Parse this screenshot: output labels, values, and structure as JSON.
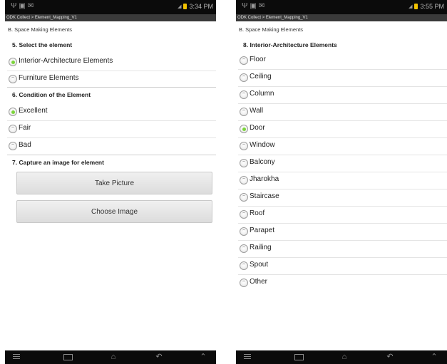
{
  "left": {
    "status_time": "3:34 PM",
    "app_title": "ODK Collect > Element_Mapping_V1",
    "section": "B. Space Making Elements",
    "q5": {
      "text": "5. Select the element",
      "options": [
        {
          "label": "Interior-Architecture Elements",
          "checked": true
        },
        {
          "label": "Furniture Elements",
          "checked": false
        }
      ]
    },
    "q6": {
      "text": "6. Condition of the Element",
      "options": [
        {
          "label": "Excellent",
          "checked": true
        },
        {
          "label": "Fair",
          "checked": false
        },
        {
          "label": "Bad",
          "checked": false
        }
      ]
    },
    "q7": {
      "text": "7. Capture an image for element",
      "take_picture": "Take Picture",
      "choose_image": "Choose Image"
    }
  },
  "right": {
    "status_time": "3:55 PM",
    "app_title": "ODK Collect > Element_Mapping_V1",
    "section": "B. Space Making Elements",
    "q8": {
      "text": "8. Interior-Architecture Elements",
      "options": [
        {
          "label": "Floor",
          "checked": false
        },
        {
          "label": "Ceiling",
          "checked": false
        },
        {
          "label": "Column",
          "checked": false
        },
        {
          "label": "Wall",
          "checked": false
        },
        {
          "label": "Door",
          "checked": true
        },
        {
          "label": "Window",
          "checked": false
        },
        {
          "label": "Balcony",
          "checked": false
        },
        {
          "label": "Jharokha",
          "checked": false
        },
        {
          "label": "Staircase",
          "checked": false
        },
        {
          "label": "Roof",
          "checked": false
        },
        {
          "label": "Parapet",
          "checked": false
        },
        {
          "label": "Railing",
          "checked": false
        },
        {
          "label": "Spout",
          "checked": false
        },
        {
          "label": "Other",
          "checked": false
        }
      ]
    }
  },
  "icons": {
    "status_left": [
      "usb-icon",
      "image-icon",
      "message-icon"
    ],
    "status_right": [
      "signal-icon",
      "battery-icon"
    ],
    "nav": [
      "menu-icon",
      "recent-apps-icon",
      "home-icon",
      "back-icon",
      "up-icon"
    ]
  },
  "colors": {
    "selected": "#7bd43a",
    "battery": "#f2c200",
    "bar": "#0b0b0b"
  }
}
